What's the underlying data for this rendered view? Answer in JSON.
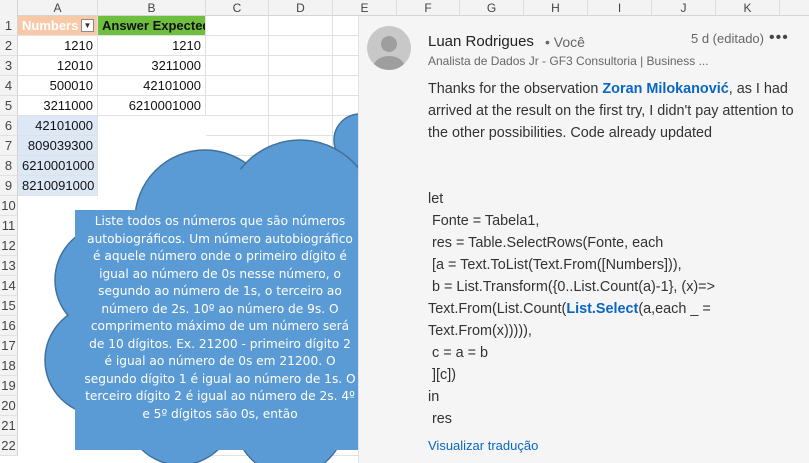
{
  "sheet": {
    "columns": [
      "A",
      "B",
      "C",
      "D",
      "E",
      "F",
      "G",
      "H",
      "I",
      "J",
      "K"
    ],
    "rows": [
      "1",
      "2",
      "3",
      "4",
      "5",
      "6",
      "7",
      "8",
      "9",
      "10",
      "11",
      "12",
      "13",
      "14",
      "15",
      "16",
      "17",
      "18",
      "19",
      "20",
      "21",
      "22"
    ],
    "header": {
      "col_a": "Numbers",
      "col_b": "Answer Expected"
    },
    "col_a_values": [
      "1210",
      "12010",
      "500010",
      "3211000",
      "42101000",
      "809039300",
      "6210001000",
      "8210091000"
    ],
    "col_b_values": [
      "1210",
      "3211000",
      "42101000",
      "6210001000"
    ],
    "colors": {
      "header_a": "#f7c9a7",
      "header_b": "#6fbf3f",
      "highlight": "#dde8f6"
    }
  },
  "cloud": {
    "text": "Liste todos os números que são números autobiográficos. Um número autobiográfico é aquele número onde o primeiro dígito é igual ao número de 0s nesse número, o segundo ao número de 1s, o terceiro ao número de 2s. 10º ao número de 9s. O comprimento máximo de um número será de 10 dígitos. Ex. 21200 - primeiro dígito 2 é igual ao número de 0s em 21200. O segundo dígito 1 é igual ao número de 1s. O terceiro dígito 2 é igual ao número de 2s. 4º e 5º dígitos são 0s, então",
    "color": "#5b9bd5"
  },
  "comment": {
    "author": "Luan Rodrigues",
    "author_tag": "• Você",
    "time": "5 d (editado)",
    "more": "•••",
    "headline": "Analista de Dados Jr - GF3 Consultoria | Business ...",
    "body_pre": "Thanks for the observation ",
    "mention": "Zoran Milokanović",
    "body_post": ", as I had arrived at the result on the first try, I didn't pay attention to the other possibilities. Code already updated",
    "code_lines": [
      "let",
      " Fonte = Tabela1,",
      " res = Table.SelectRows(Fonte, each",
      " [a = Text.ToList(Text.From([Numbers])),",
      " b = List.Transform({0..List.Count(a)-1}, (x)=>",
      "Text.From(List.Count(|List.Select|(a,each _ =",
      "Text.From(x))))),",
      " c = a = b",
      " ][c])",
      "in",
      " res"
    ],
    "translate_link": "Visualizar tradução"
  }
}
